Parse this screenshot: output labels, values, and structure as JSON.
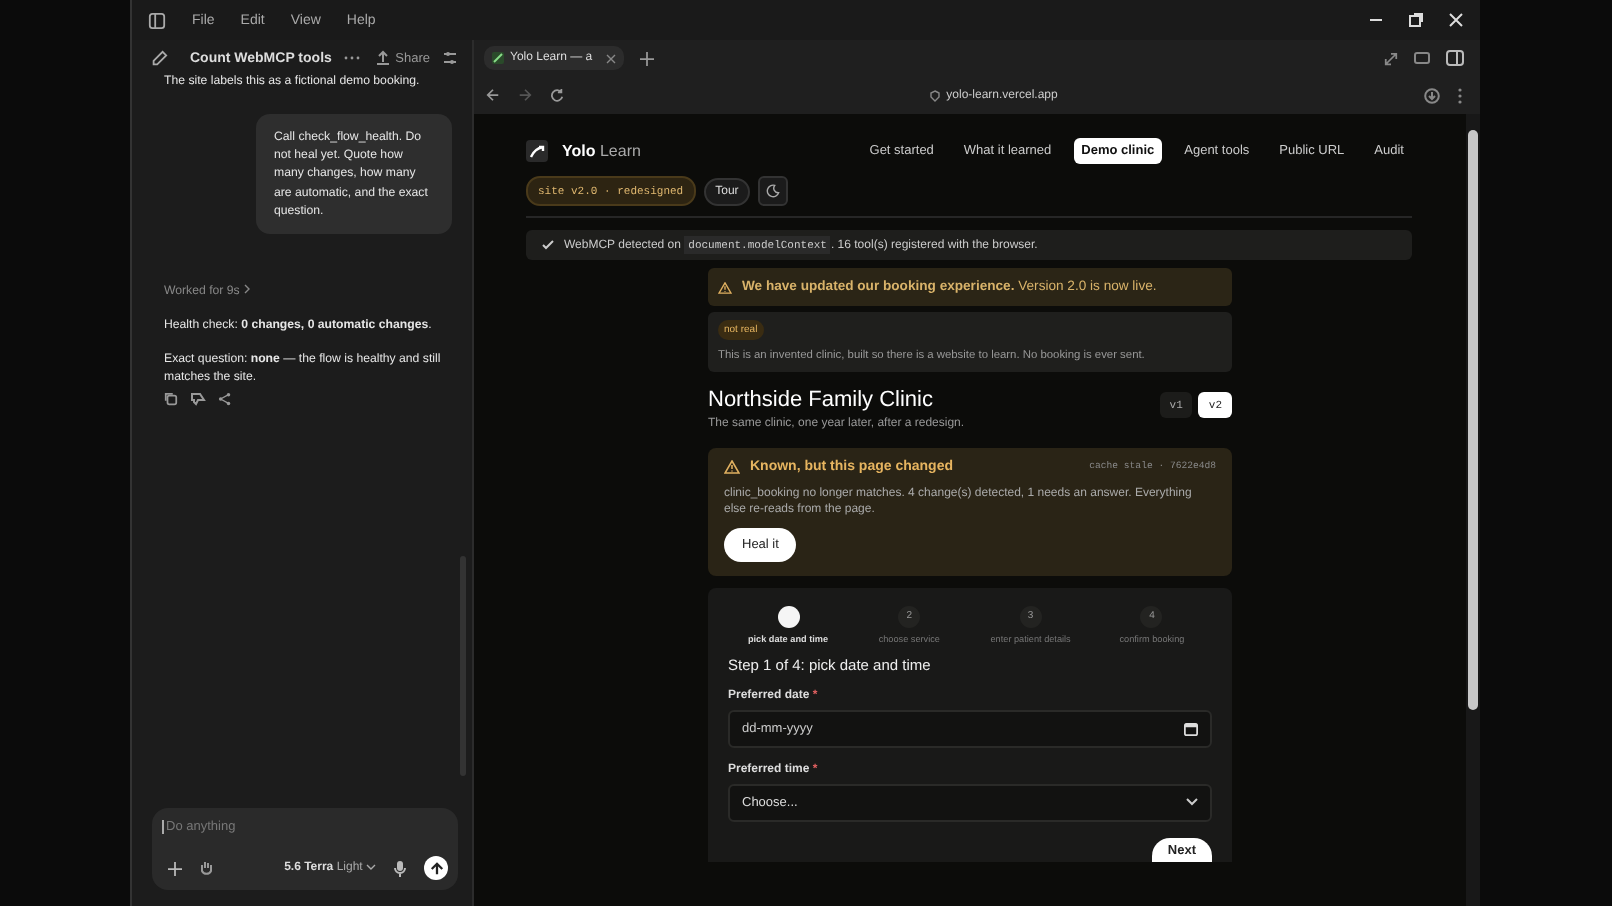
{
  "app_menu": [
    "File",
    "Edit",
    "View",
    "Help"
  ],
  "chat": {
    "title": "Count WebMCP tools",
    "share": "Share",
    "messages": [
      {
        "kind": "assistant",
        "text": "The site labels this as a fictional demo booking."
      },
      {
        "kind": "user",
        "text": "Call check_flow_health. Do not heal yet. Quote how many changes, how many are automatic, and the exact question."
      },
      {
        "kind": "status",
        "text": "Worked for 9s"
      },
      {
        "kind": "assistant",
        "text": "Health check: **0 changes, 0 automatic changes**."
      },
      {
        "kind": "assistant",
        "text": "Exact question: **none** — the flow is healthy and still matches the site."
      }
    ],
    "composer": {
      "placeholder": "Do anything",
      "model": "5.6 Terra",
      "mode": "Light"
    }
  },
  "browser": {
    "tab_title": "Yolo Learn — a",
    "url": "yolo-learn.vercel.app"
  },
  "site": {
    "brand": "Yolo",
    "brand_suffix": "Learn",
    "nav": [
      {
        "label": "Get started",
        "selected": false
      },
      {
        "label": "What it learned",
        "selected": false
      },
      {
        "label": "Demo clinic",
        "selected": true
      },
      {
        "label": "Agent tools",
        "selected": false
      },
      {
        "label": "Public URL",
        "selected": false
      },
      {
        "label": "Audit",
        "selected": false
      }
    ],
    "version_badge": "site v2.0 · redesigned",
    "tour": "Tour",
    "detection": {
      "before": "WebMCP detected on",
      "code": "document.modelContext",
      "after": ". 16 tool(s) registered with the browser."
    },
    "update_banner": "**We have updated our booking experience.** Version 2.0 is now live.",
    "notice": {
      "tag": "not real",
      "text": "This is an invented clinic, built so there is a website to learn. No booking is ever sent."
    },
    "clinic": {
      "title": "Northside Family Clinic",
      "subtitle": "The same clinic, one year later, after a redesign.",
      "versions": [
        {
          "label": "v1",
          "selected": false
        },
        {
          "label": "v2",
          "selected": true
        }
      ]
    },
    "alert": {
      "title": "Known, but this page changed",
      "meta": "cache stale · 7622e4d8",
      "text": "clinic_booking no longer matches. 4 change(s) detected, 1 needs an answer. Everything else re-reads from the page.",
      "button": "Heal it"
    },
    "wizard": {
      "steps": [
        {
          "label": "pick date and time",
          "selected": true
        },
        {
          "number": "2",
          "label": "choose service",
          "selected": false
        },
        {
          "number": "3",
          "label": "enter patient details",
          "selected": false
        },
        {
          "number": "4",
          "label": "confirm booking",
          "selected": false
        }
      ],
      "heading": "Step 1 of 4: pick date and time",
      "fields": [
        {
          "kind": "date",
          "label": "Preferred date",
          "required_mark": "*",
          "placeholder": "dd-mm-yyyy"
        },
        {
          "kind": "select",
          "label": "Preferred time",
          "required_mark": "*",
          "value": "Choose..."
        }
      ],
      "next": "Next"
    }
  }
}
